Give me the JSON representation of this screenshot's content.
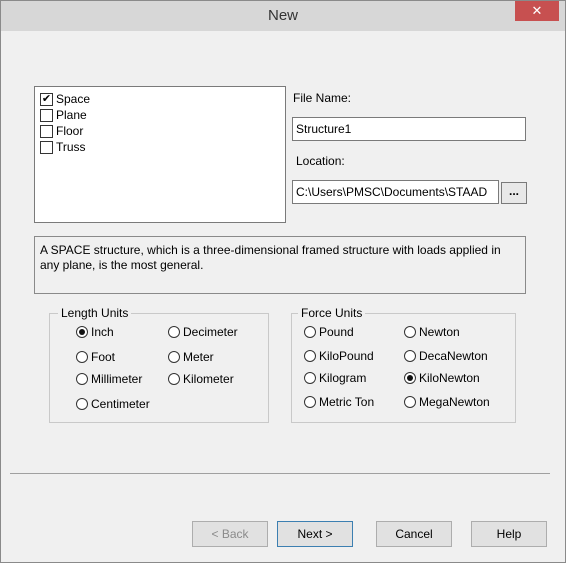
{
  "window": {
    "title": "New",
    "close_glyph": "✕"
  },
  "structure_types": [
    {
      "label": "Space",
      "checked": true
    },
    {
      "label": "Plane",
      "checked": false
    },
    {
      "label": "Floor",
      "checked": false
    },
    {
      "label": "Truss",
      "checked": false
    }
  ],
  "file_name": {
    "label": "File Name:",
    "value": "Structure1"
  },
  "location": {
    "label": "Location:",
    "value": "C:\\Users\\PMSC\\Documents\\STAAD",
    "browse_label": "..."
  },
  "description": "A SPACE structure, which is a three-dimensional framed structure with loads applied in any plane, is the most general.",
  "length_units": {
    "legend": "Length Units",
    "options": [
      {
        "label": "Inch",
        "selected": true
      },
      {
        "label": "Decimeter",
        "selected": false
      },
      {
        "label": "Foot",
        "selected": false
      },
      {
        "label": "Meter",
        "selected": false
      },
      {
        "label": "Millimeter",
        "selected": false
      },
      {
        "label": "Kilometer",
        "selected": false
      },
      {
        "label": "Centimeter",
        "selected": false
      }
    ]
  },
  "force_units": {
    "legend": "Force Units",
    "options": [
      {
        "label": "Pound",
        "selected": false
      },
      {
        "label": "Newton",
        "selected": false
      },
      {
        "label": "KiloPound",
        "selected": false
      },
      {
        "label": "DecaNewton",
        "selected": false
      },
      {
        "label": "Kilogram",
        "selected": false
      },
      {
        "label": "KiloNewton",
        "selected": true
      },
      {
        "label": "Metric Ton",
        "selected": false
      },
      {
        "label": "MegaNewton",
        "selected": false
      }
    ]
  },
  "buttons": {
    "back": "< Back",
    "next": "Next >",
    "cancel": "Cancel",
    "help": "Help"
  }
}
